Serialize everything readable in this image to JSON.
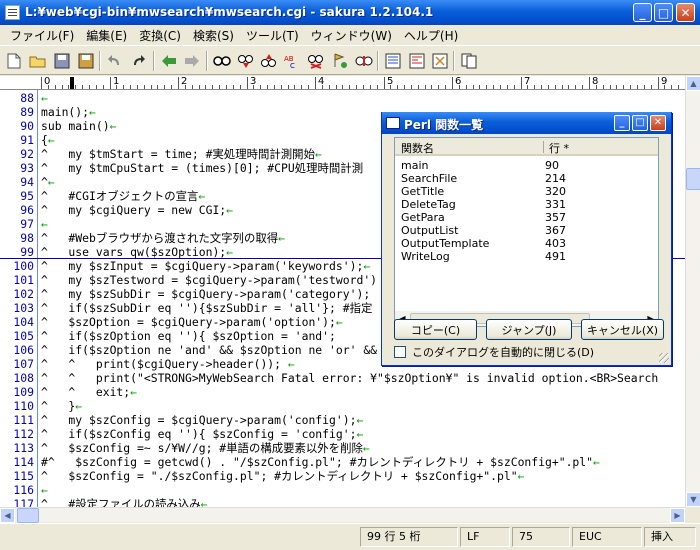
{
  "window": {
    "title": "L:¥web¥cgi-bin¥mwsearch¥mwsearch.cgi - sakura 1.2.104.1",
    "minimize": "_",
    "maximize": "□",
    "close": "✕"
  },
  "menu": [
    "ファイル(F)",
    "編集(E)",
    "変換(C)",
    "検索(S)",
    "ツール(T)",
    "ウィンドウ(W)",
    "ヘルプ(H)"
  ],
  "toolbar": {
    "buttons": [
      "new-file-icon",
      "open-folder-icon",
      "save-icon",
      "save-all-icon",
      "undo-icon",
      "redo-icon",
      "jump-back-icon",
      "jump-forward-icon",
      "search-icon",
      "search-next-icon",
      "search-prev-icon",
      "replace-icon",
      "mark-icon",
      "grep-icon",
      "compare-icon",
      "outline-icon",
      "tag-jump-icon",
      "settings-icon"
    ]
  },
  "ruler": {
    "labels": [
      "0",
      "1",
      "2",
      "3",
      "4",
      "5",
      "6",
      "7",
      "8",
      "9"
    ]
  },
  "editor": {
    "lines": [
      {
        "n": "88",
        "t": "",
        "ret": "←"
      },
      {
        "n": "89",
        "t": "main();",
        "ret": "←"
      },
      {
        "n": "90",
        "t": "sub main()",
        "ret": "←"
      },
      {
        "n": "91",
        "t": "{",
        "ret": "←"
      },
      {
        "n": "92",
        "t": "^   my $tmStart = time; #実処理時間計測開始",
        "ret": "←"
      },
      {
        "n": "93",
        "t": "^   my $tmCpuStart = (times)[0]; #CPU処理時間計測",
        "ret": ""
      },
      {
        "n": "94",
        "t": "^",
        "ret": "←"
      },
      {
        "n": "95",
        "t": "^   #CGIオブジェクトの宣言",
        "ret": "←"
      },
      {
        "n": "96",
        "t": "^   my $cgiQuery = new CGI;",
        "ret": "←"
      },
      {
        "n": "97",
        "t": "",
        "ret": "←"
      },
      {
        "n": "98",
        "t": "^   #Webブラウザから渡された文字列の取得",
        "ret": "←"
      },
      {
        "n": "99",
        "t": "^   use vars qw($szOption);",
        "ret": "←"
      },
      {
        "n": "100",
        "t": "^   my $szInput = $cgiQuery->param('keywords');",
        "ret": "←"
      },
      {
        "n": "101",
        "t": "^   my $szTestword = $cgiQuery->param('testword')",
        "ret": ""
      },
      {
        "n": "102",
        "t": "^   my $szSubDir = $cgiQuery->param('category');",
        "ret": ""
      },
      {
        "n": "103",
        "t": "^   if($szSubDir eq ''){$szSubDir = 'all'}; #指定",
        "ret": ""
      },
      {
        "n": "104",
        "t": "^   $szOption = $cgiQuery->param('option');",
        "ret": "←"
      },
      {
        "n": "105",
        "t": "^   if($szOption eq ''){ $szOption = 'and';",
        "ret": ""
      },
      {
        "n": "106",
        "t": "^   if($szOption ne 'and' && $szOption ne 'or' &&",
        "ret": ""
      },
      {
        "n": "107",
        "t": "^   ^   print($cgiQuery->header()); ",
        "ret": "←"
      },
      {
        "n": "108",
        "t": "^   ^   print(\"<STRONG>MyWebSearch Fatal error: ¥\"$szOption¥\" is invalid option.<BR>Search",
        "ret": ""
      },
      {
        "n": "109",
        "t": "^   ^   exit;",
        "ret": "←"
      },
      {
        "n": "110",
        "t": "^   }",
        "ret": "←"
      },
      {
        "n": "111",
        "t": "^   my $szConfig = $cgiQuery->param('config');",
        "ret": "←"
      },
      {
        "n": "112",
        "t": "^   if($szConfig eq ''){ $szConfig = 'config';",
        "ret": "←"
      },
      {
        "n": "113",
        "t": "^   $szConfig =~ s/¥W//g; #単語の構成要素以外を削除",
        "ret": "←"
      },
      {
        "n": "114",
        "t": "#^   $szConfig = getcwd() . \"/$szConfig.pl\"; #カレントディレクトリ + $szConfig+\".pl\"",
        "ret": "←"
      },
      {
        "n": "115",
        "t": "^   $szConfig = \"./$szConfig.pl\"; #カレントディレクトリ + $szConfig+\".pl\"",
        "ret": "←"
      },
      {
        "n": "116",
        "t": "",
        "ret": "←"
      },
      {
        "n": "117",
        "t": "^   #設定ファイルの読み込み",
        "ret": "←"
      }
    ]
  },
  "status": {
    "position": "99 行  5 桁",
    "newline": "LF",
    "charcode": "75",
    "encoding": "EUC",
    "mode": "挿入"
  },
  "dialog": {
    "title": "Perl 関数一覧",
    "col_name": "関数名",
    "col_line": "行 *",
    "rows": [
      {
        "name": "main",
        "line": "90"
      },
      {
        "name": "SearchFile",
        "line": "214"
      },
      {
        "name": "GetTitle",
        "line": "320"
      },
      {
        "name": "DeleteTag",
        "line": "331"
      },
      {
        "name": "GetPara",
        "line": "357"
      },
      {
        "name": "OutputList",
        "line": "367"
      },
      {
        "name": "OutputTemplate",
        "line": "403"
      },
      {
        "name": "WriteLog",
        "line": "491"
      }
    ],
    "copy_label": "コピー(C)",
    "jump_label": "ジャンプ(J)",
    "cancel_label": "キャンセル(X)",
    "auto_close_label": "このダイアログを自動的に閉じる(D)",
    "auto_close_checked": false
  },
  "colors": {
    "titlebar": "#0a5fd8",
    "line_number": "#0000c0",
    "return_mark": "#00a000",
    "panel": "#ece9d8"
  }
}
